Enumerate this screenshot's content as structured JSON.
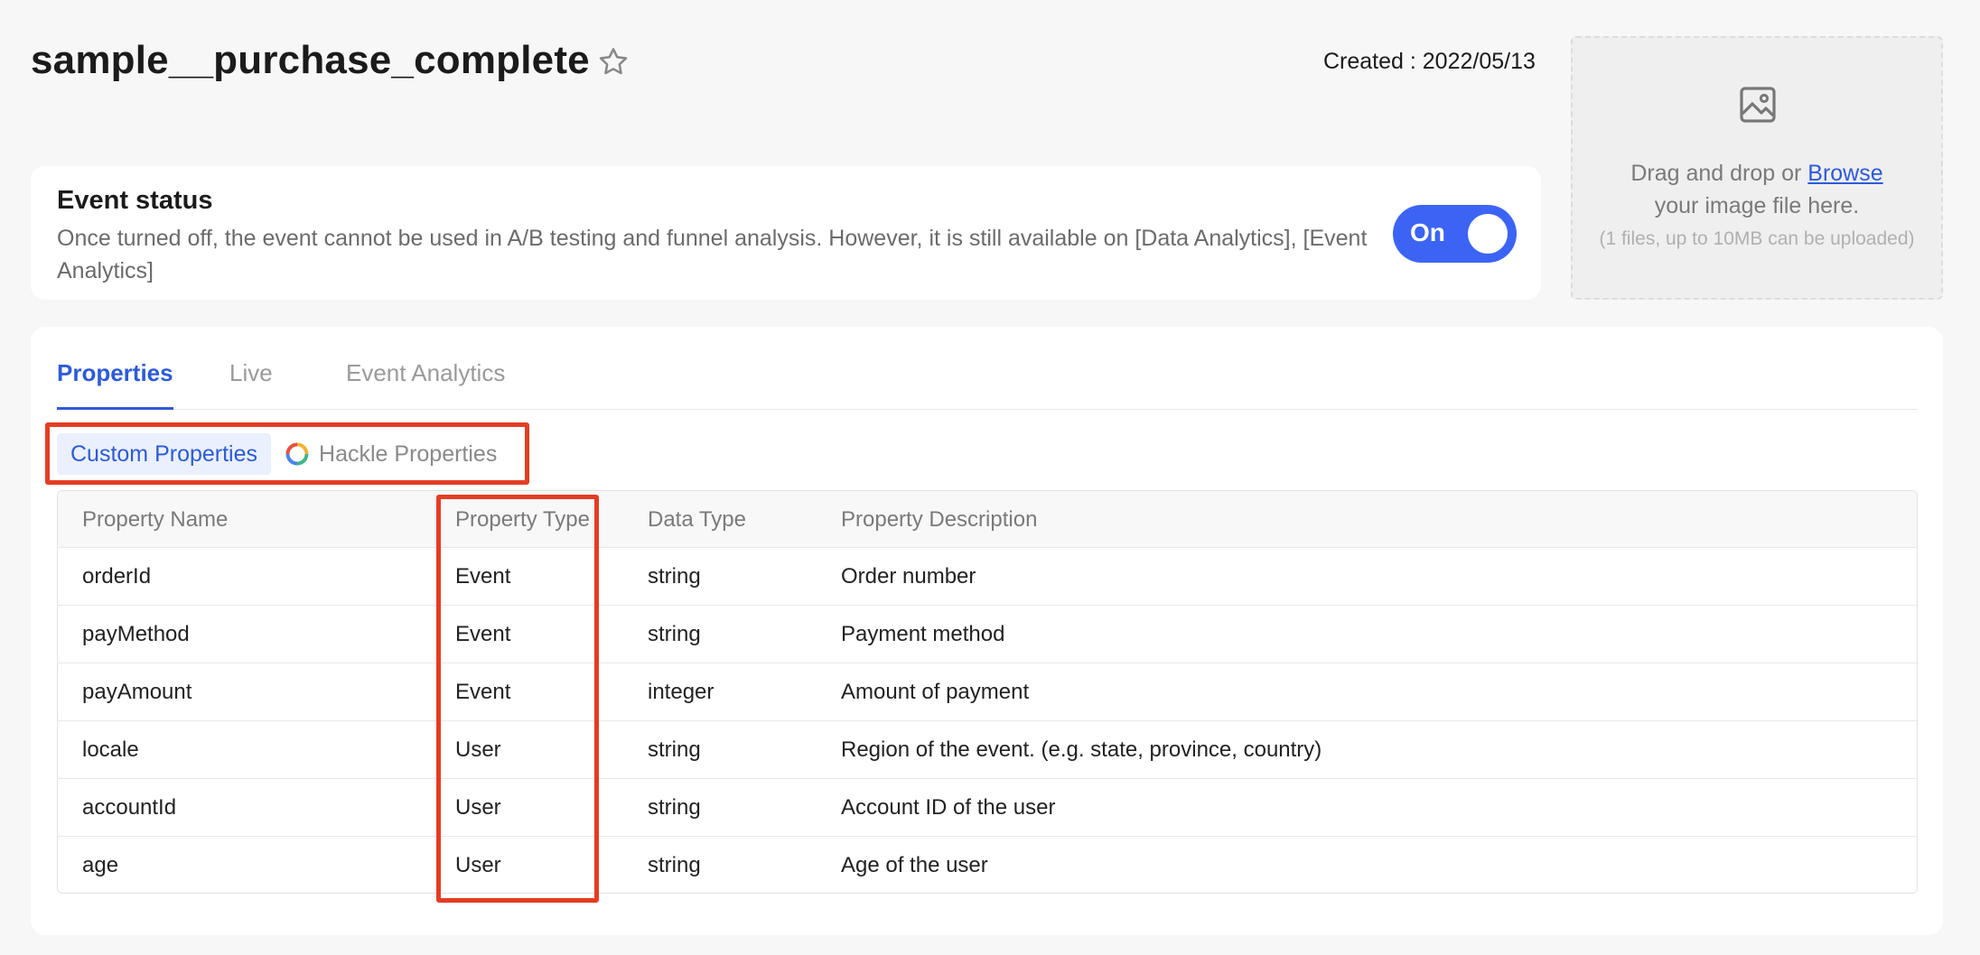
{
  "header": {
    "title": "sample__purchase_complete",
    "created": "Created : 2022/05/13"
  },
  "status": {
    "title": "Event status",
    "description": "Once turned off, the event cannot be used in A/B testing and funnel analysis. However, it is still available on [Data Analytics], [Event Analytics]",
    "toggle_label": "On",
    "toggle_on": true
  },
  "upload": {
    "line1_prefix": "Drag and drop or ",
    "browse_label": "Browse",
    "line2": "your image file here.",
    "note": "(1 files, up to 10MB can be uploaded)"
  },
  "tabs": [
    {
      "label": "Properties",
      "active": true
    },
    {
      "label": "Live",
      "active": false
    },
    {
      "label": "Event Analytics",
      "active": false
    }
  ],
  "segments": [
    {
      "label": "Custom Properties",
      "active": true
    },
    {
      "label": "Hackle Properties",
      "active": false
    }
  ],
  "table": {
    "columns": [
      "Property Name",
      "Property Type",
      "Data Type",
      "Property Description"
    ],
    "rows": [
      [
        "orderId",
        "Event",
        "string",
        "Order number"
      ],
      [
        "payMethod",
        "Event",
        "string",
        "Payment method"
      ],
      [
        "payAmount",
        "Event",
        "integer",
        "Amount of payment"
      ],
      [
        "locale",
        "User",
        "string",
        "Region of the event. (e.g. state, province, country)"
      ],
      [
        "accountId",
        "User",
        "string",
        "Account ID of the user"
      ],
      [
        "age",
        "User",
        "string",
        "Age of the user"
      ]
    ]
  },
  "colors": {
    "accent": "#3c64f4",
    "link": "#2d5bd8",
    "highlight": "#e43d24"
  }
}
